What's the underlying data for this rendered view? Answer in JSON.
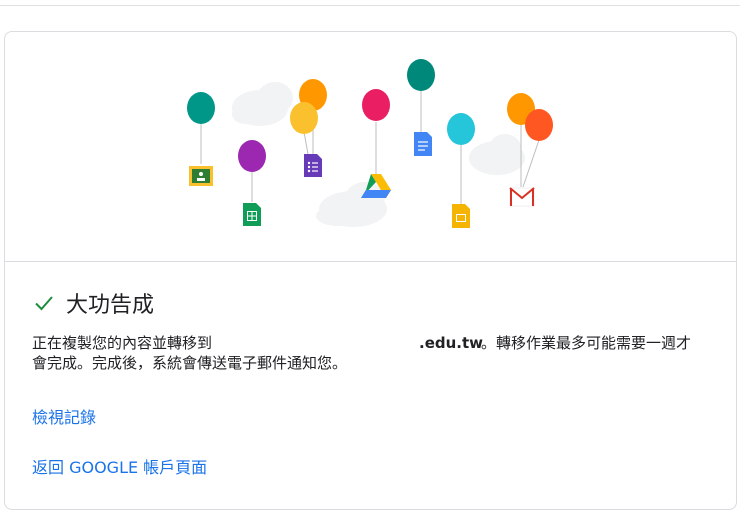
{
  "success": {
    "title": "大功告成"
  },
  "message": {
    "prefix": "正在複製您的內容並轉移到",
    "domain": ".edu.tw",
    "suffix": "。轉移作業最多可能需要一週才",
    "line2": "會完成。完成後，系統會傳送電子郵件通知您。"
  },
  "links": {
    "history": "檢視記錄",
    "back": "返回 GOOGLE 帳戶頁面"
  },
  "colors": {
    "accent": "#1a73e8",
    "success": "#1e8e3e"
  },
  "illustration": {
    "icons": [
      "classroom-icon",
      "sheets-icon",
      "forms-icon",
      "drive-icon",
      "docs-icon",
      "slides-icon",
      "gmail-icon"
    ]
  }
}
